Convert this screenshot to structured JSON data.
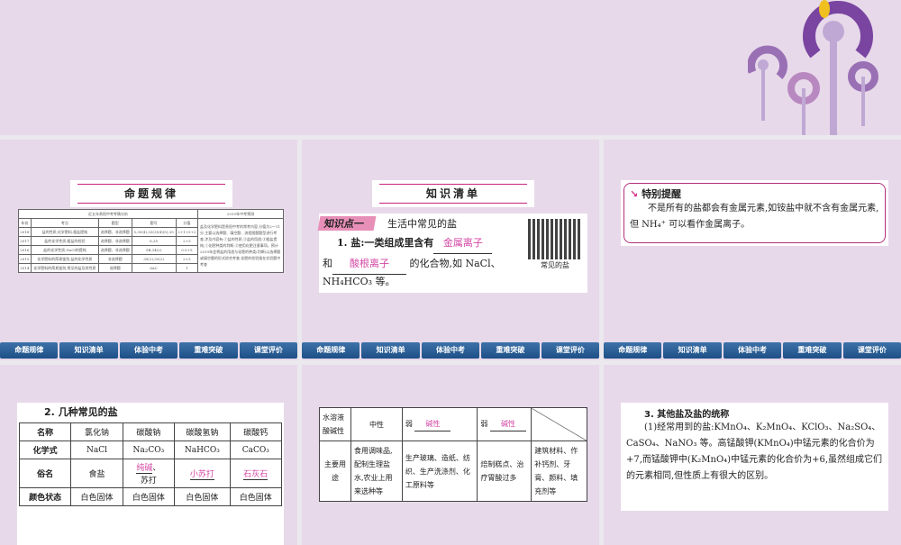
{
  "nav": [
    "命题规律",
    "知识清单",
    "体验中考",
    "重难突破",
    "课堂评价"
  ],
  "slide1": {
    "banner": "命题规律",
    "table_title": "近五年贵阳中考考情分析",
    "pred_title": "2019年中考预测",
    "headers": [
      "年份",
      "考点",
      "题型",
      "题号",
      "分值"
    ],
    "rows": [
      [
        "2018",
        "盐的性质,化学肥料,粗盐提纯",
        "选择题、非选择题",
        "5,30(4),33(3)(4)(5),35",
        "2+1+5+2"
      ],
      [
        "2017",
        "盐的化学性质;粗盐的检验",
        "选择题、非选择题",
        "6,35",
        "2+3"
      ],
      [
        "2016",
        "盐的化学性质;NaCl的提纯",
        "选择题、非选择题",
        "5B;34(2)",
        "0.5+5"
      ],
      [
        "2015",
        "化学肥料的简易鉴别;盐的化学性质",
        "非选择题",
        "30(2);35(2)",
        "2+3"
      ],
      [
        "2014",
        "化学肥料的简易鉴别;常见的盐及其性质",
        "选择题",
        "6AC",
        "1"
      ]
    ],
    "prediction": "盐及化学肥料是贵阳中考的常考内容,分值为2～11分,主要以选择题、填空题、流程图题题型进行考查,涉及内容有:①盐的性质;②盐的用途;③粗盐提纯;①化肥种类的判断;②使用化肥注意事项。预计2019年会将盐的用途与化肥的种类(判断)以选择题或填空题的形式综合考查,化肥的检验插在实验题中考查"
  },
  "slide2": {
    "banner": "知识清单",
    "tag": "知识点一",
    "title": "生活中常见的盐",
    "p1": "1. 盐:一类组成里含有",
    "blank1": "金属离子",
    "p2": "和",
    "blank2": "酸根离子",
    "p3": "的化合物,如 NaCl、",
    "p4": "NH₄HCO₃ 等。",
    "qr_caption": "常见的盐"
  },
  "slide3": {
    "title": "特别提醒",
    "text": "不是所有的盐都会有金属元素,如铵盐中就不含有金属元素,但 NH₄⁺ 可以看作金属离子。"
  },
  "slide4": {
    "title": "2. 几种常见的盐",
    "rows": [
      {
        "h": "名称",
        "c": [
          "氯化钠",
          "碳酸钠",
          "碳酸氢钠",
          "碳酸钙"
        ]
      },
      {
        "h": "化学式",
        "c": [
          "NaCl",
          "Na₂CO₃",
          "NaHCO₃",
          "CaCO₃"
        ]
      },
      {
        "h": "俗名",
        "c": [
          "食盐",
          "",
          "",
          ""
        ]
      },
      {
        "h": "颜色状态",
        "c": [
          "白色固体",
          "白色固体",
          "白色固体",
          "白色固体"
        ]
      }
    ],
    "nickname_blanks": [
      "纯碱",
      "小苏打",
      "石灰石"
    ],
    "suda": "苏打"
  },
  "slide5": {
    "r1h": "水溶液酸碱性",
    "r1": [
      "中性",
      "弱",
      "碱性",
      "弱",
      "碱性"
    ],
    "r2h": "主要用途",
    "r2": [
      "食用调味品,配制生理盐水,农业上用来选种等",
      "生产玻璃、造纸、纺织、生产洗涤剂、化工原料等",
      "焙制糕点、治疗胃酸过多",
      "建筑材料、作补钙剂、牙膏、颜料、填充剂等"
    ]
  },
  "slide6": {
    "title": "3. 其他盐及盐的统称",
    "text": "(1)经常用到的盐:KMnO₄、K₂MnO₄、KClO₃、Na₂SO₄、CaSO₄、NaNO₃ 等。高锰酸钾(KMnO₄)中锰元素的化合价为+7,而锰酸钾中(K₂MnO₄)中锰元素的化合价为+6,虽然组成它们的元素相同,但性质上有很大的区别。"
  }
}
